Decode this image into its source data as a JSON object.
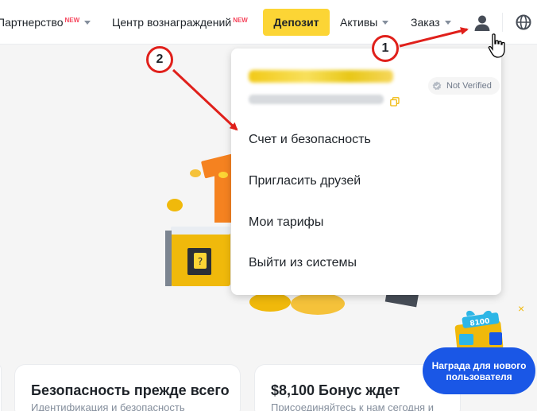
{
  "nav": {
    "partnership": "Партнерство",
    "partnership_badge": "NEW",
    "rewards_center": "Центр вознаграждений",
    "rewards_badge": "NEW",
    "deposit": "Депозит",
    "assets": "Активы",
    "orders": "Заказ"
  },
  "account_menu": {
    "verify_status": "Not Verified",
    "items": [
      "Счет и безопасность",
      "Пригласить друзей",
      "Мои тарифы",
      "Выйти из системы"
    ]
  },
  "cards": [
    {
      "title": "Безопасность прежде всего",
      "subtitle": "Идентификация и безопасность"
    },
    {
      "title": "$8,100 Бонус ждет",
      "subtitle": "Присоединяйтесь к нам сегодня и"
    }
  ],
  "reward_widget": {
    "label": "Награда для нового пользователя",
    "gift_text": "8100",
    "close": "×"
  },
  "annotations": {
    "step1": "1",
    "step2": "2",
    "color": "#e0201b"
  },
  "colors": {
    "brand_yellow": "#fcd535",
    "reward_blue": "#1a57e6"
  }
}
